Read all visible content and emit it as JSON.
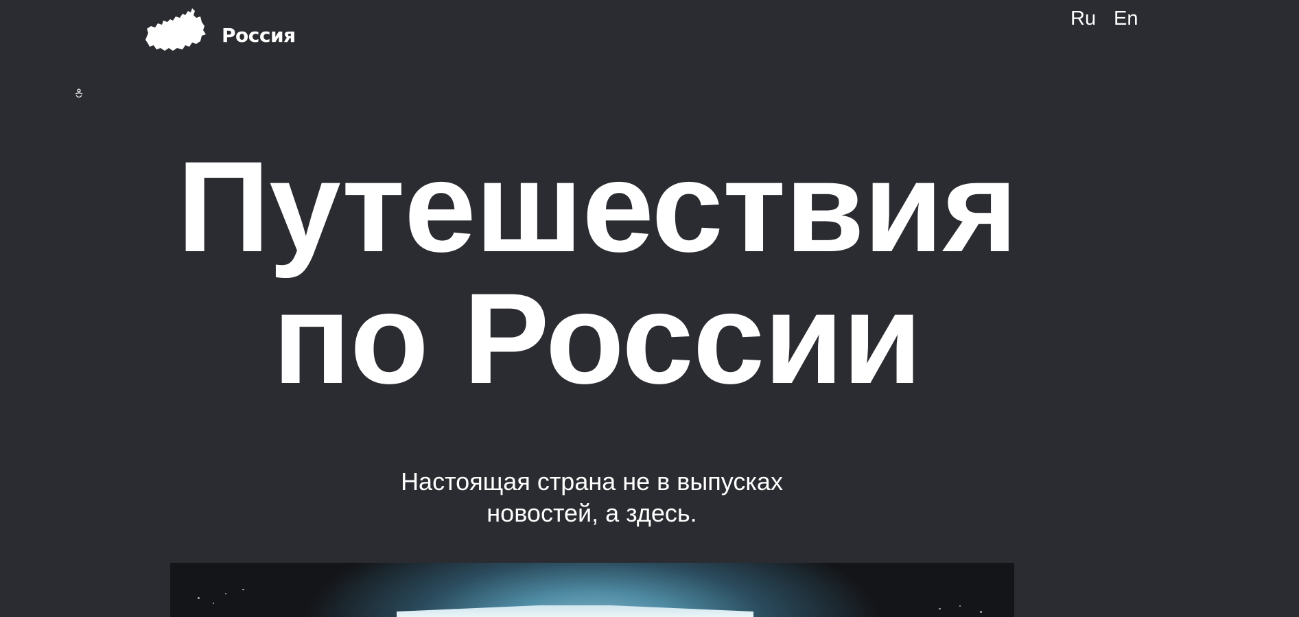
{
  "header": {
    "logo_text": "Россия",
    "logo_icon": "russia-map-icon",
    "languages": [
      {
        "label": "Ru"
      },
      {
        "label": "En"
      }
    ],
    "accessibility_icon": "accessibility-icon"
  },
  "hero": {
    "title_line1": "Путешествия",
    "title_line2": "по России",
    "subtitle_line1": "Настоящая страна не в выпусках",
    "subtitle_line2": "новостей, а здесь."
  },
  "colors": {
    "background": "#2b2c31",
    "text": "#ffffff"
  }
}
